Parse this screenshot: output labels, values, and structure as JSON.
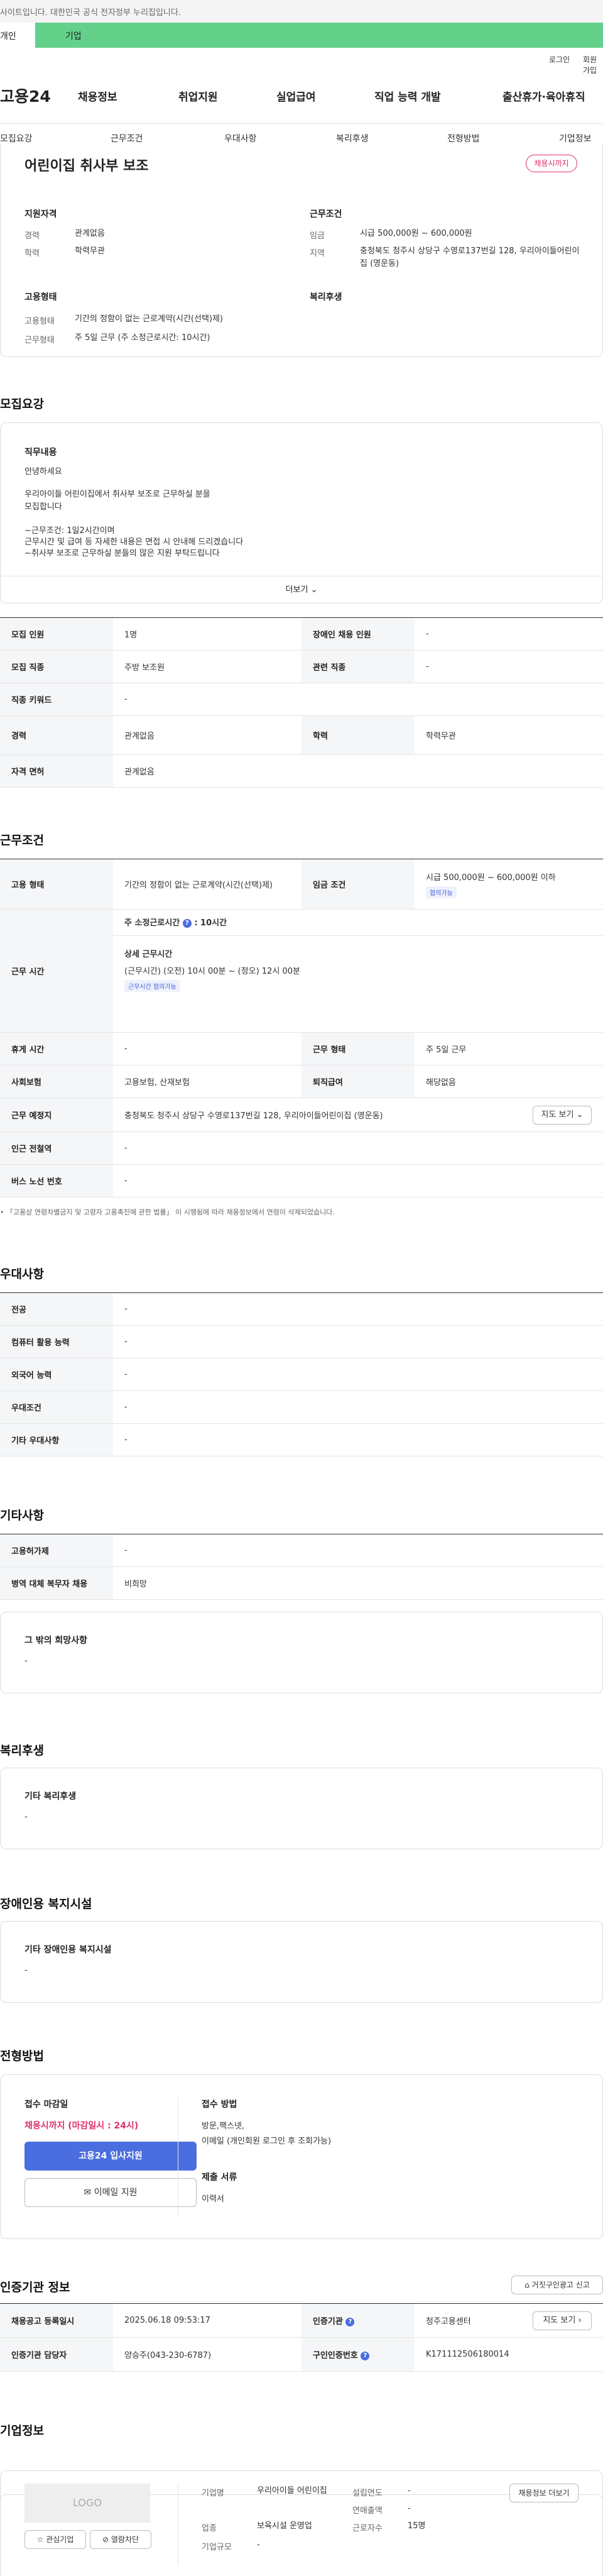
{
  "top": {
    "notice": "사이트입니다. 대한민국 공식 전자정부 누리집입니다.",
    "tab_personal": "개인",
    "tab_company": "기업"
  },
  "util": {
    "login": "로그인",
    "join": "회원가입"
  },
  "gnb": {
    "logo": "고용24",
    "menu": [
      "채용정보",
      "취업지원",
      "실업급여",
      "직업 능력 개발",
      "출산휴가·육아휴직"
    ]
  },
  "subnav": [
    "모집요강",
    "근무조건",
    "우대사항",
    "복리후생",
    "전형방법",
    "기업정보"
  ],
  "summary": {
    "title": "어린이집 취사부 보조",
    "status": "채용시까지",
    "qual_title": "지원자격",
    "cond_title": "근무조건",
    "career_k": "경력",
    "career_v": "관계없음",
    "edu_k": "학력",
    "edu_v": "학력무관",
    "wage_k": "임금",
    "wage_v": "시급 500,000원 ~ 600,000원",
    "area_k": "지역",
    "area_v": "충청북도 청주시 상당구 수영로137번길 128, 우리아이들어린이집 (영운동)",
    "emp_title": "고용형태",
    "welfare_title": "복리후생",
    "emptype_k": "고용형태",
    "emptype_v": "기간의 정함이 없는 근로계약(시간(선택)제)",
    "worktype_k": "근무형태",
    "worktype_v": "주 5일 근무 (주 소정근로시간: 10시간)"
  },
  "recruit": {
    "title": "모집요강",
    "duty_title": "직무내용",
    "lines": [
      "안녕하세요",
      "우리아이들 어린이집에서 취사부 보조로 근무하실 분을",
      "모집합니다",
      "~근무조건: 1일2시간이며",
      "근무시간 및 급여 등 자세한 내용은 면접 시 안내해 드리겠습니다",
      "~취사부 보조로 근무하실 분들의 많은 지원 부탁드립니다"
    ],
    "more": "더보기",
    "rows": [
      [
        "모집 인원",
        "1명",
        "장애인 채용 인원",
        "-"
      ],
      [
        "모집 직종",
        "주방 보조원",
        "관련 직종",
        "-"
      ],
      [
        "직종 키워드",
        "-"
      ],
      [
        "경력",
        "관계없음",
        "학력",
        "학력무관"
      ],
      [
        "자격 면허",
        "관계없음"
      ]
    ]
  },
  "work": {
    "title": "근무조건",
    "emptype_k": "고용 형태",
    "emptype_v": "기간의 정함이 없는 근로계약(시간(선택)제)",
    "wage_k": "임금 조건",
    "wage_v": "시급 500,000원 ~ 600,000원 이하",
    "wage_badge": "협의가능",
    "hours_k": "근무 시간",
    "hours_head": "주 소정근로시간",
    "hours_val": ": 10시간",
    "detail_head": "상세 근무시간",
    "detail_v": "(근무시간) (오전) 10시 00분 ~ (정오) 12시 00분",
    "detail_badge": "근무시간 협의가능",
    "rows": [
      [
        "휴게 시간",
        "-",
        "근무 형태",
        "주 5일 근무"
      ],
      [
        "사회보험",
        "고용보험, 산재보험",
        "퇴직급여",
        "해당없음"
      ]
    ],
    "place_k": "근무 예정지",
    "place_v": "충청북도 청주시 상당구 수영로137번길 128, 우리아이들어린이집 (영운동)",
    "map_btn": "지도 보기",
    "subway_k": "인근 전철역",
    "subway_v": "-",
    "bus_k": "버스 노선 번호",
    "bus_v": "-",
    "note": "「고용상 연령차별금지 및 고령자 고용촉진에 관한 법률」 이 시행됨에 따라 채용정보에서 연령이 삭제되었습니다."
  },
  "pref": {
    "title": "우대사항",
    "rows": [
      [
        "전공",
        "-"
      ],
      [
        "컴퓨터 활용 능력",
        "-"
      ],
      [
        "외국어 능력",
        "-"
      ],
      [
        "우대조건",
        "-"
      ],
      [
        "기타 우대사항",
        "-"
      ]
    ]
  },
  "etc": {
    "title": "기타사항",
    "rows": [
      [
        "고용허가제",
        "-"
      ],
      [
        "병역 대체 복무자 채용",
        "비희망"
      ]
    ],
    "box_title": "그 밖의 희망사항",
    "box_v": "-"
  },
  "welfare": {
    "title": "복리후생",
    "box_title": "기타 복리후생",
    "box_v": "-"
  },
  "disab": {
    "title": "장애인용 복지시설",
    "box_title": "기타 장애인용 복지시설",
    "box_v": "-"
  },
  "process": {
    "title": "전형방법",
    "deadline_k": "접수 마감일",
    "deadline_v": "채용시까지 (마감일시 : 24시)",
    "apply_btn": "고용24 입사지원",
    "email_btn": "이메일 지원",
    "method_k": "접수 방법",
    "method_v1": "방문,팩스넷,",
    "method_v2": "이메일 (개인회원 로그인 후 조회가능)",
    "docs_k": "제출 서류",
    "docs_v": "이력서"
  },
  "cert": {
    "title": "인증기관 정보",
    "report_btn": "거짓구인광고 신고",
    "rows": [
      [
        "채용공고 등록일시",
        "2025.06.18 09:53:17",
        "인증기관",
        "청주고용센터"
      ],
      [
        "인증기관 담당자",
        "양승주(043-230-6787)",
        "구인인증번호",
        "K171112506180014"
      ]
    ],
    "map_btn": "지도 보기"
  },
  "company": {
    "title": "기업정보",
    "logo": "LOGO",
    "fav_btn": "관심기업",
    "block_btn": "열람차단",
    "name_k": "기업명",
    "name_v": "우리아이들 어린이집",
    "biz_k": "업종",
    "biz_v": "보육시설 운영업",
    "scale_k": "기업규모",
    "scale_v": "-",
    "year_k": "설립연도",
    "year_v": "-",
    "sales_k": "연매출액",
    "sales_v": "-",
    "emp_k": "근로자수",
    "emp_v": "15명",
    "jobs_btn": "채용정보 더보기"
  }
}
